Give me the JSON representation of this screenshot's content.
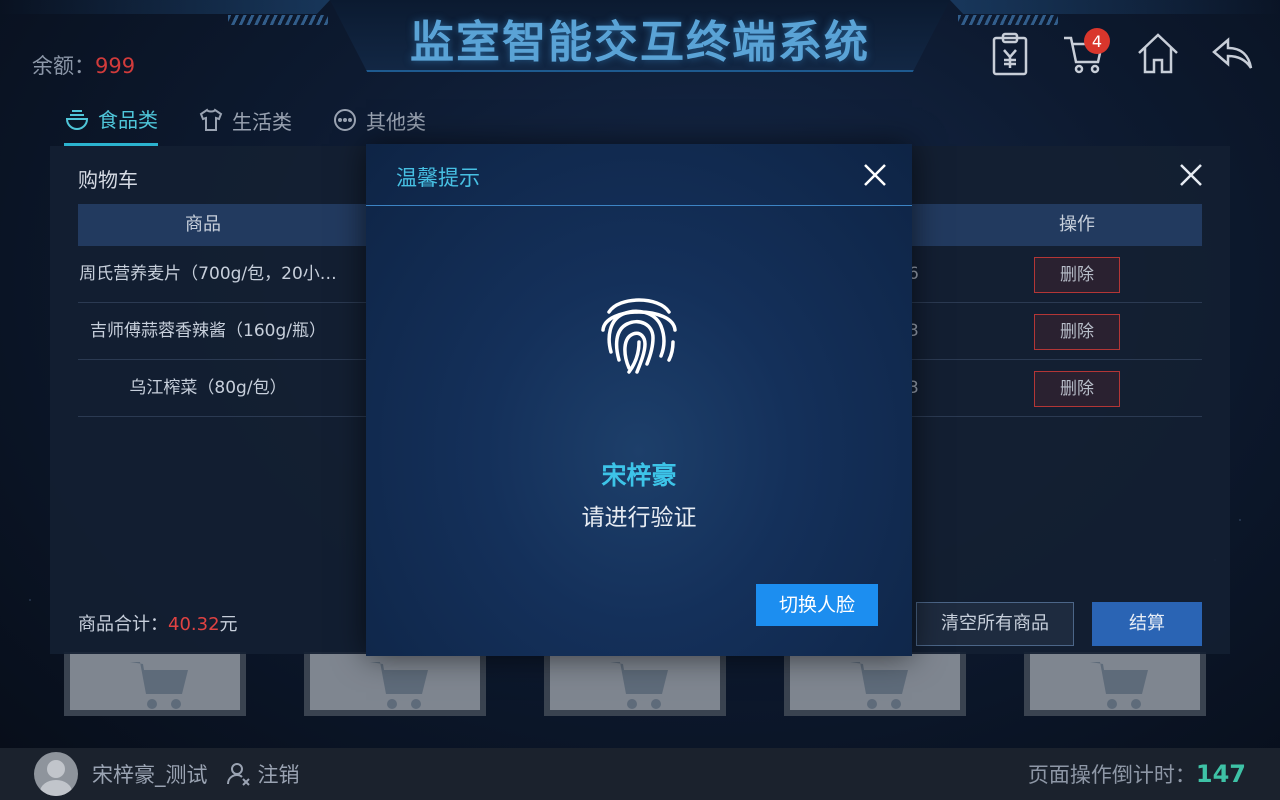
{
  "header": {
    "title": "监室智能交互终端系统",
    "balance_label": "余额：",
    "balance_value": "999",
    "cart_badge": "4",
    "icons": [
      "receipt-icon",
      "cart-icon",
      "home-icon",
      "back-icon"
    ]
  },
  "tabs": [
    {
      "label": "食品类",
      "icon": "bowl-icon",
      "active": true
    },
    {
      "label": "生活类",
      "icon": "shirt-icon",
      "active": false
    },
    {
      "label": "其他类",
      "icon": "more-icon",
      "active": false
    }
  ],
  "cart": {
    "title": "购物车",
    "col_goods": "商品",
    "col_operation": "操作",
    "rows": [
      {
        "name": "周氏营养麦片（700g/包，20小…",
        "qty": "6",
        "action": "删除"
      },
      {
        "name": "吉师傅蒜蓉香辣酱（160g/瓶）",
        "qty": "3",
        "action": "删除"
      },
      {
        "name": "乌江榨菜（80g/包）",
        "qty": "3",
        "action": "删除"
      }
    ],
    "total_label": "商品合计：",
    "total_value": "40.32",
    "total_unit": "元",
    "clear_label": "清空所有商品",
    "checkout_label": "结算"
  },
  "modal": {
    "title": "温馨提示",
    "user_name": "宋梓豪",
    "message": "请进行验证",
    "switch_label": "切换人脸"
  },
  "footer": {
    "user": "宋梓豪_测试",
    "logout_label": "注销",
    "countdown_label": "页面操作倒计时：",
    "countdown_value": "147"
  },
  "colors": {
    "accent": "#3dc4e8",
    "danger": "#d9362c",
    "primary_button": "#1c8ef0",
    "countdown": "#3ec2a6"
  }
}
